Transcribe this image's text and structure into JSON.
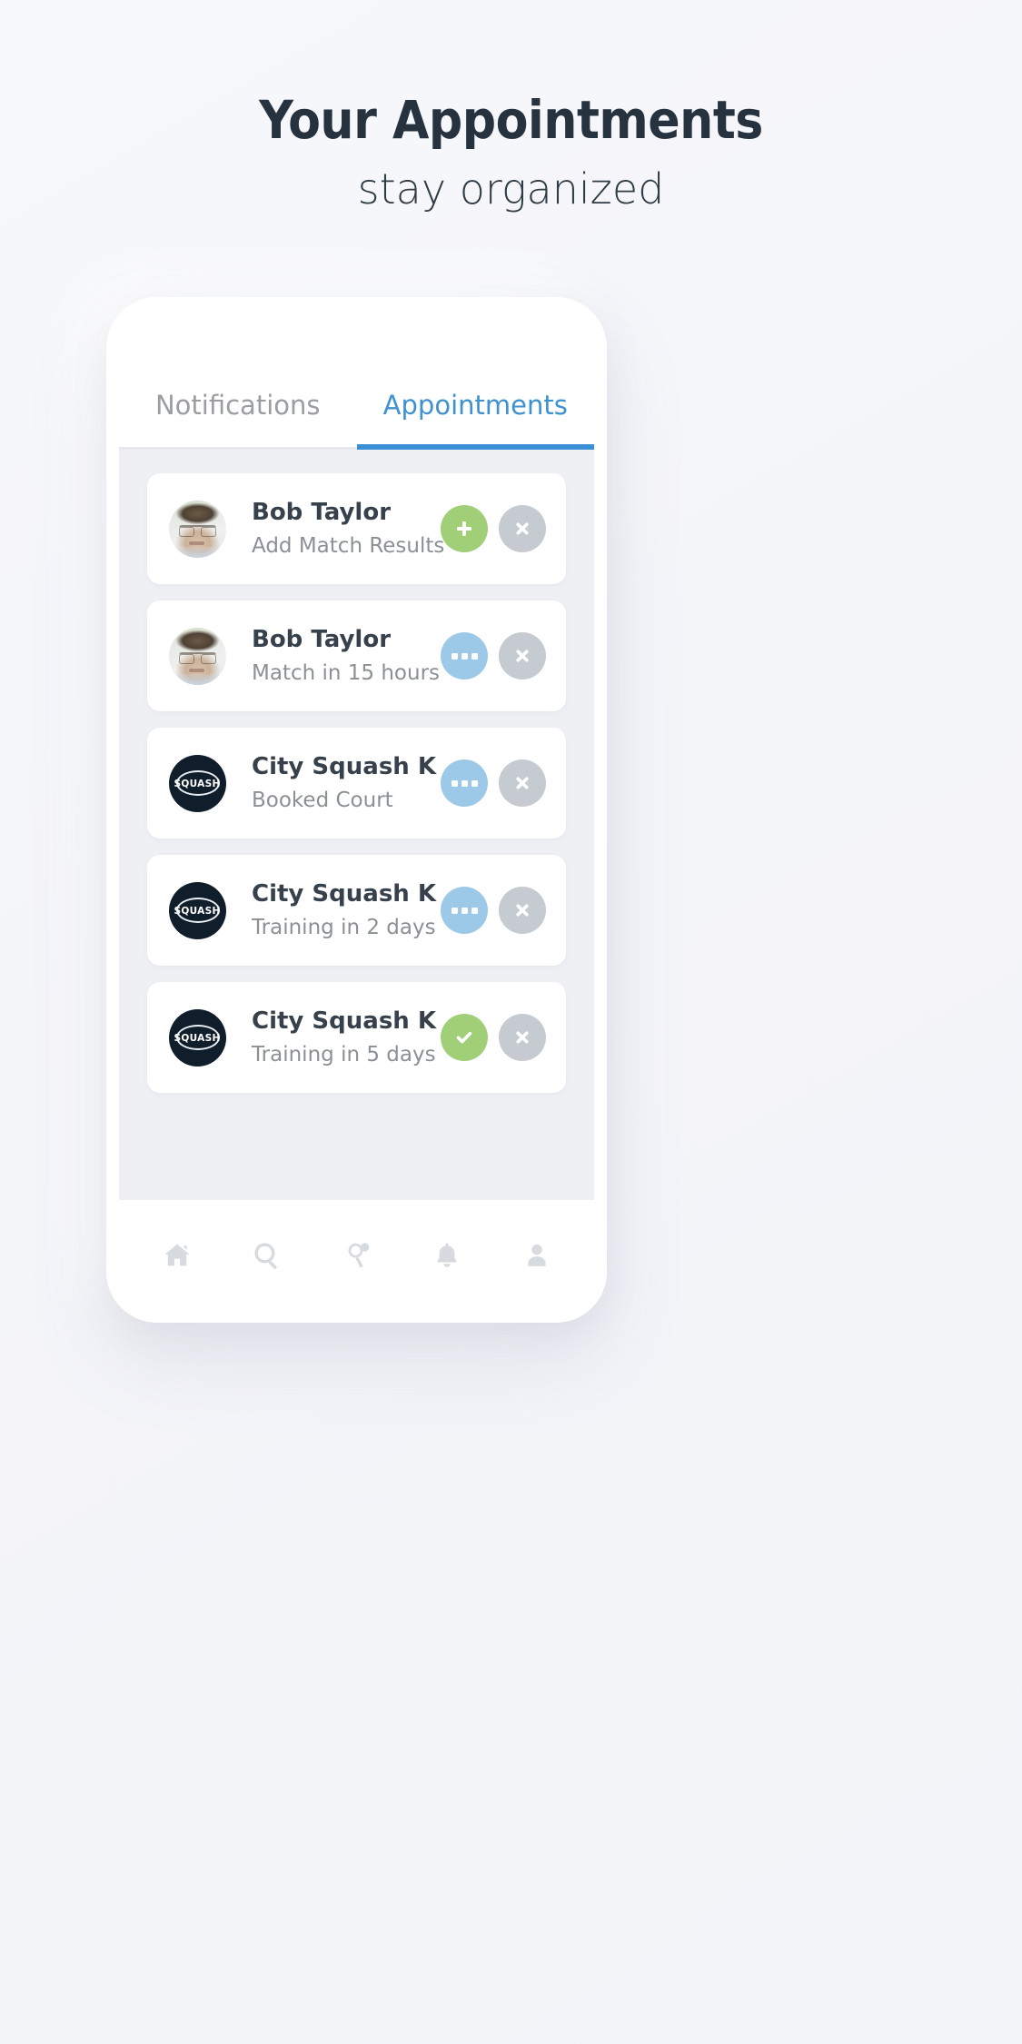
{
  "header": {
    "title": "Your Appointments",
    "subtitle": "stay organized"
  },
  "colors": {
    "accent_blue": "#3b8fd4",
    "tab_active_text": "#3f92d2",
    "tab_inactive_text": "#9a9da2",
    "action_green": "#a0cf77",
    "action_blue": "#9dc9e8",
    "action_grey": "#c6cad1",
    "title_navy": "#26333f",
    "card_title": "#36414c",
    "card_subtitle": "#8b9096",
    "list_background": "#eef0f4",
    "logo_navy": "#101d2b"
  },
  "tabs": [
    {
      "label": "Notifications",
      "active": false
    },
    {
      "label": "Appointments",
      "active": true
    }
  ],
  "appointments": [
    {
      "name": "Bob Taylor",
      "detail": "Add Match Results",
      "avatar": "photo",
      "primary_action": "plus-icon",
      "primary_color": "green",
      "secondary_action": "close-icon"
    },
    {
      "name": "Bob Taylor",
      "detail": "Match in 15 hours",
      "avatar": "photo",
      "primary_action": "more-icon",
      "primary_color": "blue",
      "secondary_action": "close-icon"
    },
    {
      "name": "City Squash K",
      "detail": "Booked Court",
      "avatar": "logo",
      "logo_text": "SQUASH",
      "primary_action": "more-icon",
      "primary_color": "blue",
      "secondary_action": "close-icon"
    },
    {
      "name": "City Squash K",
      "detail": "Training in 2 days",
      "avatar": "logo",
      "logo_text": "SQUASH",
      "primary_action": "more-icon",
      "primary_color": "blue",
      "secondary_action": "close-icon"
    },
    {
      "name": "City Squash K",
      "detail": "Training in 5 days",
      "avatar": "logo",
      "logo_text": "SQUASH",
      "primary_action": "check-icon",
      "primary_color": "green",
      "secondary_action": "close-icon"
    }
  ],
  "bottom_nav": [
    {
      "icon": "home-icon"
    },
    {
      "icon": "search-icon"
    },
    {
      "icon": "racquet-icon"
    },
    {
      "icon": "bell-icon"
    },
    {
      "icon": "profile-icon"
    }
  ]
}
